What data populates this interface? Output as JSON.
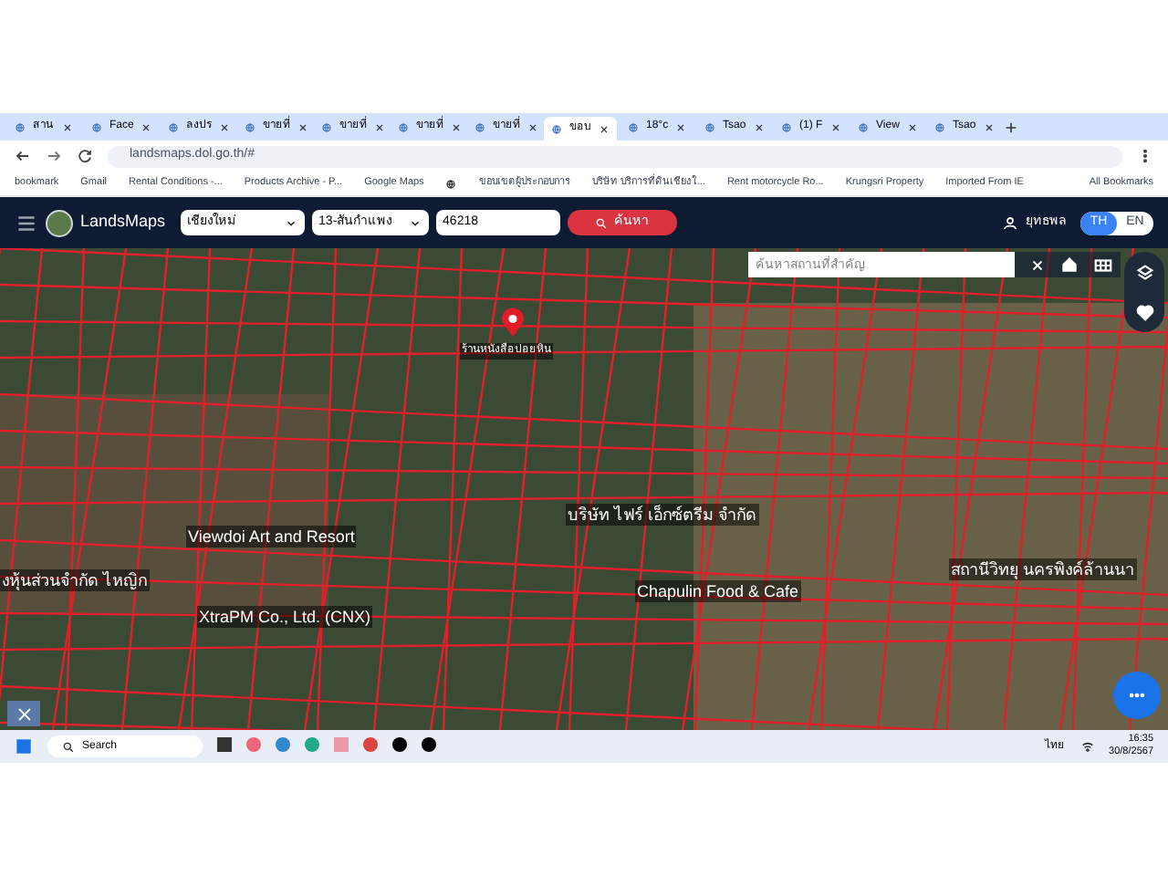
{
  "browser": {
    "tabs": [
      {
        "label": "สาน",
        "selected": false
      },
      {
        "label": "Face",
        "selected": false
      },
      {
        "label": "ลงปร",
        "selected": false
      },
      {
        "label": "ขายที่",
        "selected": false
      },
      {
        "label": "ขายที่",
        "selected": false
      },
      {
        "label": "ขายที่",
        "selected": false
      },
      {
        "label": "ขายที่",
        "selected": false
      },
      {
        "label": "ขอบ",
        "selected": true
      },
      {
        "label": "18°c",
        "selected": false
      },
      {
        "label": "Tsao",
        "selected": false
      },
      {
        "label": "(1) F",
        "selected": false
      },
      {
        "label": "View",
        "selected": false
      },
      {
        "label": "Tsao",
        "selected": false
      }
    ],
    "url": "landsmaps.dol.go.th/#",
    "bookmarks": [
      "bookmark",
      "Gmail",
      "Rental Conditions -...",
      "Products Archive - P...",
      "Google Maps",
      "ขอบเขตผู้ประกอบการ",
      "บริษัท บริการที่ดินเชียงใ...",
      "Rent motorcycle Ro...",
      "Krungsri Property",
      "Imported From IE"
    ],
    "all_bookmarks": "All Bookmarks"
  },
  "app": {
    "logo": "LandsMaps",
    "province": "เชียงใหม่",
    "district": "13-สันกำแพง",
    "parcel": "46218",
    "search_button": "ค้นหา",
    "user": "ยุทธพล",
    "languages": [
      {
        "label": "TH",
        "selected": true
      },
      {
        "label": "EN",
        "selected": false
      }
    ],
    "place_search": {
      "placeholder": "ค้นหาสถานที่สำคัญ"
    },
    "map_labels": [
      {
        "text": "ร้านหนังสือปอยหิน",
        "kind": "pin"
      },
      {
        "text": "Viewdoi Art and Resort",
        "kind": "plain"
      },
      {
        "text": "XtraPM Co., Ltd. (CNX)",
        "kind": "plain"
      },
      {
        "text": "บริษัท ไฟร์ เอ็กซ์ตรีม จำกัด",
        "kind": "plain"
      },
      {
        "text": "Chapulin Food & Cafe",
        "kind": "plain"
      },
      {
        "text": "สถานีวิทยุ นครพิงค์ล้านนา",
        "kind": "plain"
      },
      {
        "text": "งหุ้นส่วนจำกัด ไหญิก",
        "kind": "plain"
      }
    ]
  },
  "taskbar": {
    "search": "Search",
    "language": "ไทย",
    "time": "16:35",
    "date": "30/8/2567"
  }
}
